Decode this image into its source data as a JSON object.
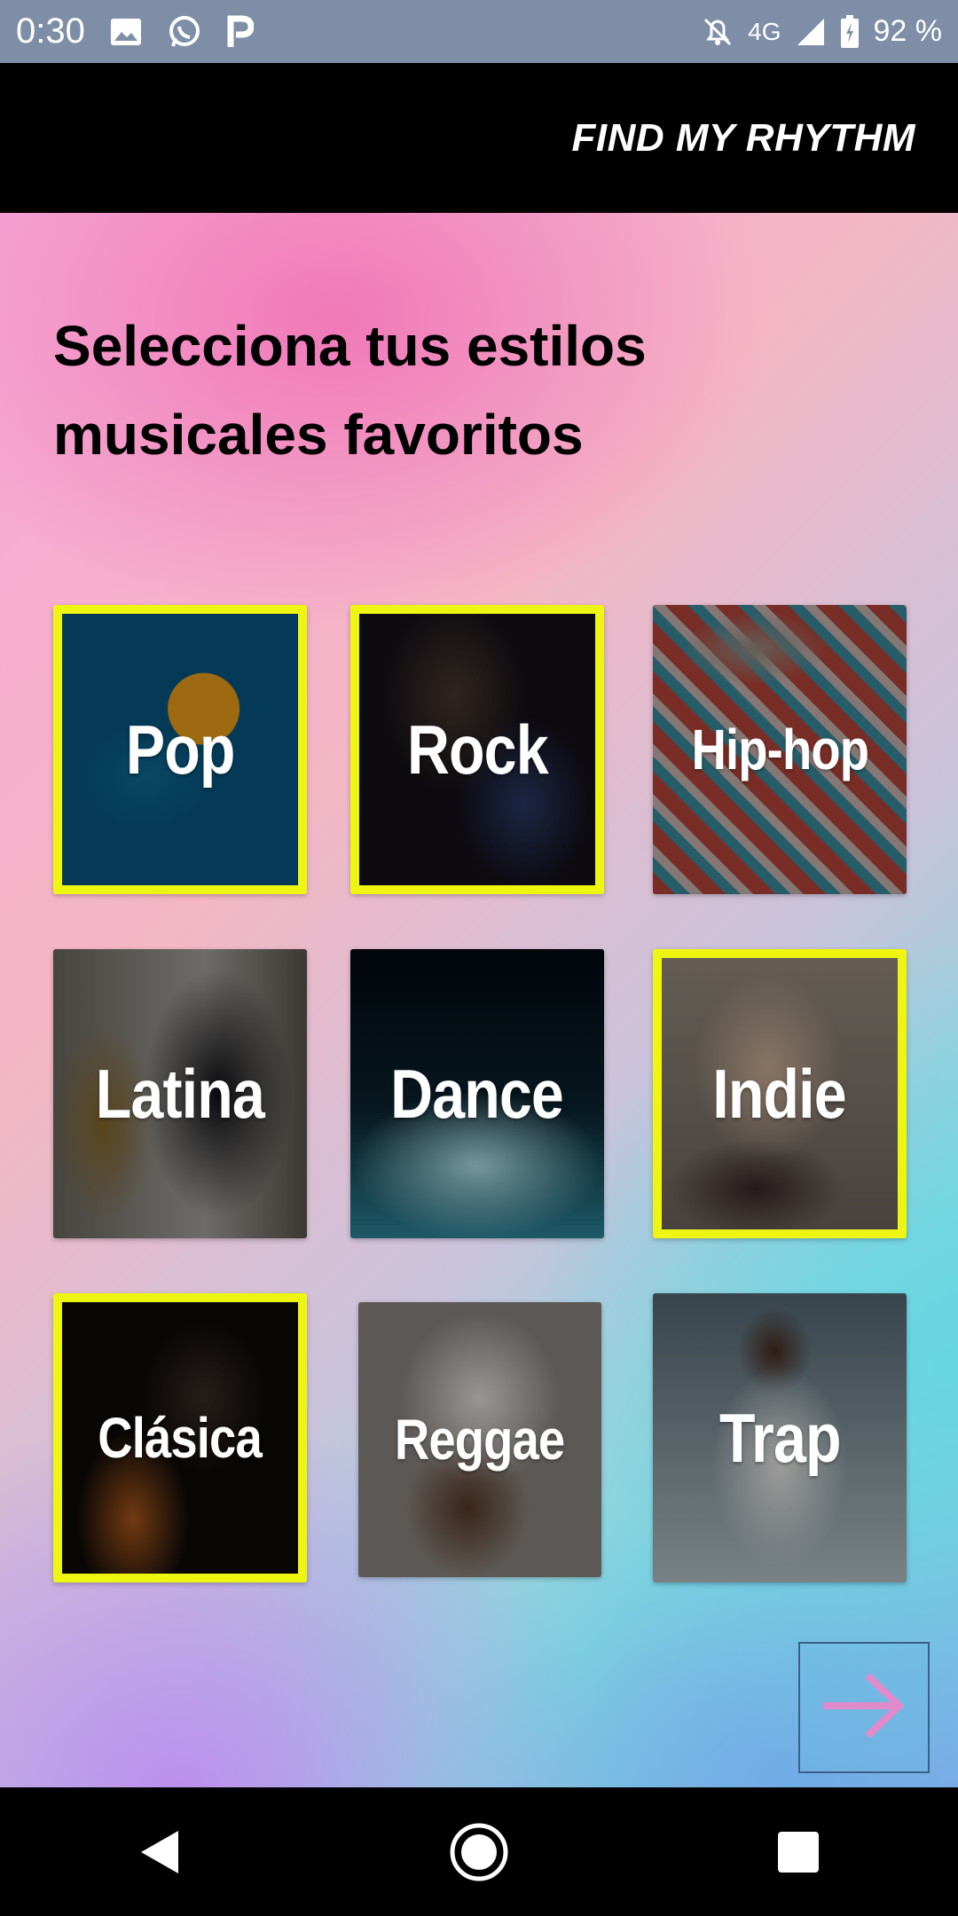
{
  "status_bar": {
    "time": "0:30",
    "network": "4G",
    "battery": "92 %",
    "icons_left": [
      "image-icon",
      "whatsapp-icon",
      "p-app-icon"
    ],
    "icons_right": [
      "alarm-off-icon",
      "signal-icon",
      "battery-icon"
    ]
  },
  "app_bar": {
    "title": "FIND MY RHYTHM"
  },
  "heading": "Selecciona tus estilos musicales favoritos",
  "genres": [
    {
      "label": "Pop",
      "selected": true
    },
    {
      "label": "Rock",
      "selected": true
    },
    {
      "label": "Hip-hop",
      "selected": false
    },
    {
      "label": "Latina",
      "selected": false
    },
    {
      "label": "Dance",
      "selected": false
    },
    {
      "label": "Indie",
      "selected": true
    },
    {
      "label": "Clásica",
      "selected": true
    },
    {
      "label": "Reggae",
      "selected": false
    },
    {
      "label": "Trap",
      "selected": false
    }
  ],
  "next_button": {
    "icon": "arrow-right-icon",
    "color": "#e08acb"
  },
  "colors": {
    "selected_border": "#eef510",
    "app_bar_bg": "#000000",
    "status_bar_bg": "#7f8ea7"
  },
  "nav_bar": {
    "icons": [
      "back-icon",
      "home-icon",
      "recents-icon"
    ]
  }
}
